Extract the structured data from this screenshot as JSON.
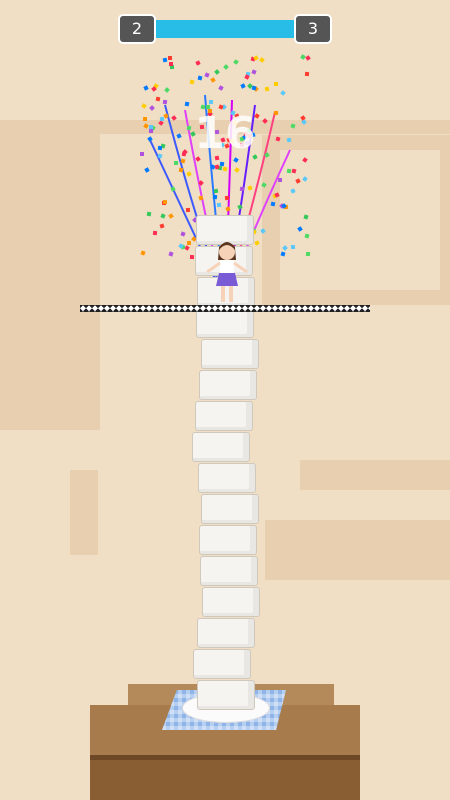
{
  "hud": {
    "current_level": "2",
    "next_level": "3",
    "progress": 1.0,
    "score": "16"
  },
  "colors": {
    "background": "#f0dfc4",
    "progress_fill": "#27bde6",
    "level_box": "#555555",
    "block": "#f6f4f0",
    "table": "#a77b4c",
    "napkin": "#8fb4e8"
  },
  "tower": {
    "block_count": 16
  },
  "icons": {
    "character": "girl-character-icon",
    "finish": "checkered-finish-line",
    "effect": "confetti-celebration"
  }
}
